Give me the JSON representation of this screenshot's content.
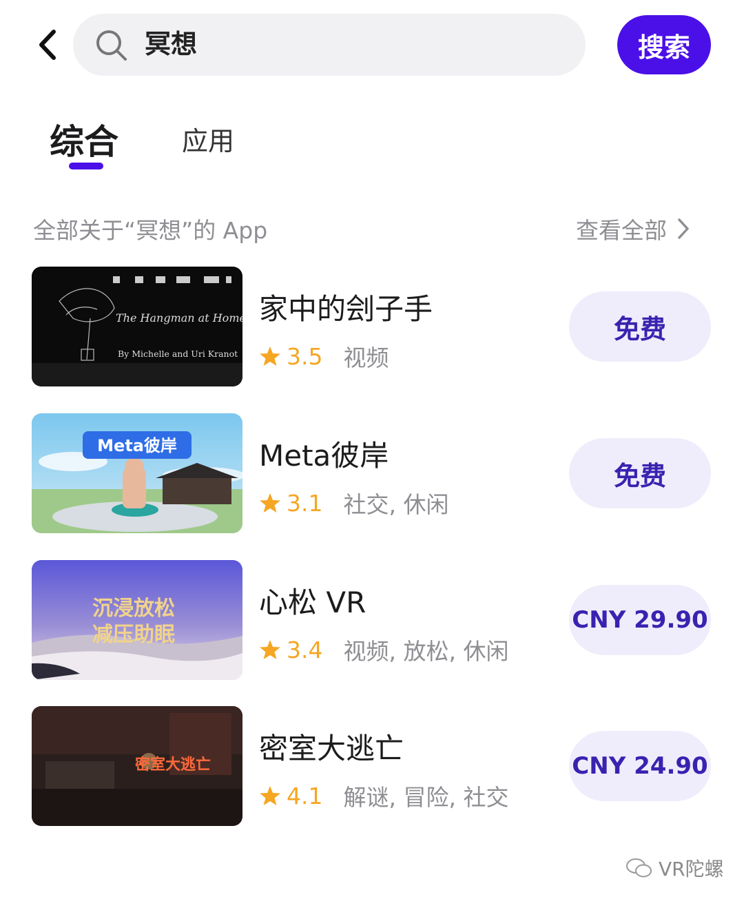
{
  "search": {
    "query": "冥想",
    "button_label": "搜索"
  },
  "tabs": [
    {
      "label": "综合",
      "active": true
    },
    {
      "label": "应用",
      "active": false
    }
  ],
  "section": {
    "title": "全部关于“冥想”的 App",
    "view_all": "查看全部"
  },
  "apps": [
    {
      "name": "家中的刽子手",
      "rating": "3.5",
      "tags": "视频",
      "price": "免费",
      "thumb_title": "The Hangman at Home - VR",
      "thumb_credit": "By Michelle and Uri Kranot"
    },
    {
      "name": "Meta彼岸",
      "rating": "3.1",
      "tags": "社交, 休闲",
      "price": "免费",
      "thumb_title": "Meta彼岸"
    },
    {
      "name": "心松 VR",
      "rating": "3.4",
      "tags": "视频, 放松, 休闲",
      "price": "CNY 29.90",
      "thumb_line1": "沉浸放松",
      "thumb_line2": "减压助眠"
    },
    {
      "name": "密室大逃亡",
      "rating": "4.1",
      "tags": "解谜, 冒险, 社交",
      "price": "CNY 24.90",
      "thumb_title": "密室大逃亡"
    }
  ],
  "watermark": "VR陀螺",
  "colors": {
    "accent": "#4b10e8",
    "rating": "#f5a623",
    "price_bg": "#efedfb"
  }
}
